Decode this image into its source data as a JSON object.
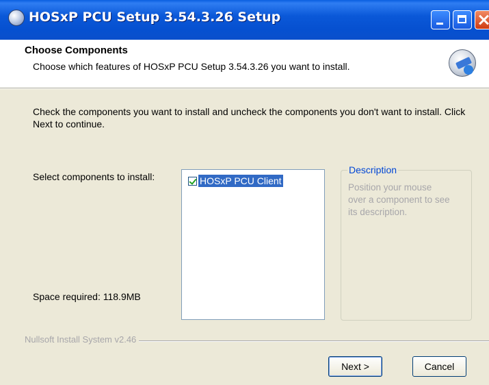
{
  "window": {
    "title": "HOSxP PCU Setup 3.54.3.26 Setup",
    "controls": [
      "minimize-icon",
      "maximize-icon",
      "close-icon"
    ]
  },
  "header": {
    "title": "Choose Components",
    "subtitle": "Choose which features of HOSxP PCU Setup 3.54.3.26 you want to install."
  },
  "body": {
    "instructions": "Check the components you want to install and uncheck the components you don't want to install. Click Next to continue.",
    "select_label": "Select components to install:",
    "components": [
      {
        "label": "HOSxP PCU Client",
        "checked": true,
        "selected": true
      }
    ],
    "space_required": "Space required: 118.9MB",
    "description": {
      "title": "Description",
      "text": "Position your mouse over a component to see its description."
    }
  },
  "footer": {
    "branding": "Nullsoft Install System v2.46",
    "next_label": "Next >",
    "cancel_label": "Cancel"
  },
  "colors": {
    "titlebar": "#0a58d8",
    "selection": "#316ac5",
    "window_bg": "#ece9d8",
    "description_title": "#0046d5"
  }
}
